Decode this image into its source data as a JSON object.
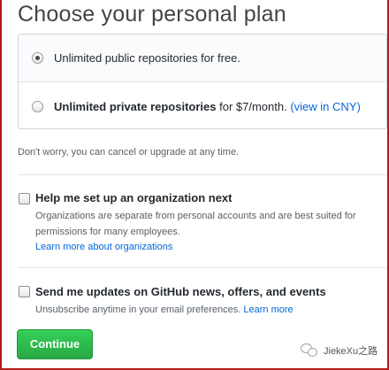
{
  "page": {
    "title": "Choose your personal plan"
  },
  "plans": {
    "free": {
      "label": "Unlimited public repositories for free.",
      "selected": true
    },
    "private": {
      "label_bold": "Unlimited private repositories",
      "label_rest": " for $7/month. ",
      "link": "(view in CNY)",
      "selected": false
    }
  },
  "note": "Don't worry, you can cancel or upgrade at any time.",
  "organization": {
    "title": "Help me set up an organization next",
    "desc_line1": "Organizations are separate from personal accounts and are best suited for",
    "desc_line2": "permissions for many employees.",
    "link": "Learn more about organizations",
    "checked": false
  },
  "updates": {
    "title": "Send me updates on GitHub news, offers, and events",
    "desc": "Unsubscribe anytime in your email preferences. ",
    "link": "Learn more",
    "checked": false
  },
  "actions": {
    "continue_label": "Continue"
  },
  "watermark": {
    "icon": "chat-bubbles-icon",
    "text": "JiekeXu之路"
  },
  "colors": {
    "accent_green": "#28a745",
    "link_blue": "#0366d6",
    "frame_red": "#b01c1c"
  }
}
